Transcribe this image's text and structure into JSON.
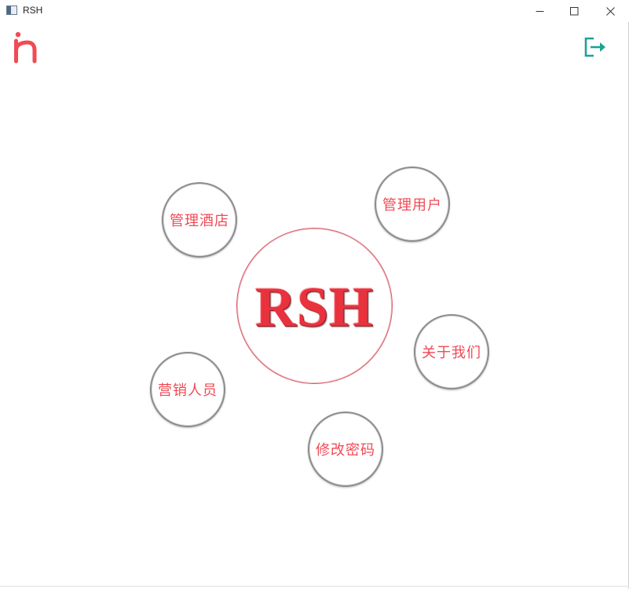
{
  "window": {
    "title": "RSH",
    "minimize_icon": "minimize-icon",
    "maximize_icon": "maximize-icon",
    "close_icon": "close-icon"
  },
  "header": {
    "logo_icon": "h-logo-icon",
    "logout_icon": "logout-icon",
    "accent_color": "#f04a55",
    "logout_color": "#1aa394"
  },
  "center": {
    "label": "RSH"
  },
  "menu": {
    "manage_hotels": "管理酒店",
    "manage_users": "管理用户",
    "about_us": "关于我们",
    "marketing_staff": "营销人员",
    "change_password": "修改密码"
  }
}
